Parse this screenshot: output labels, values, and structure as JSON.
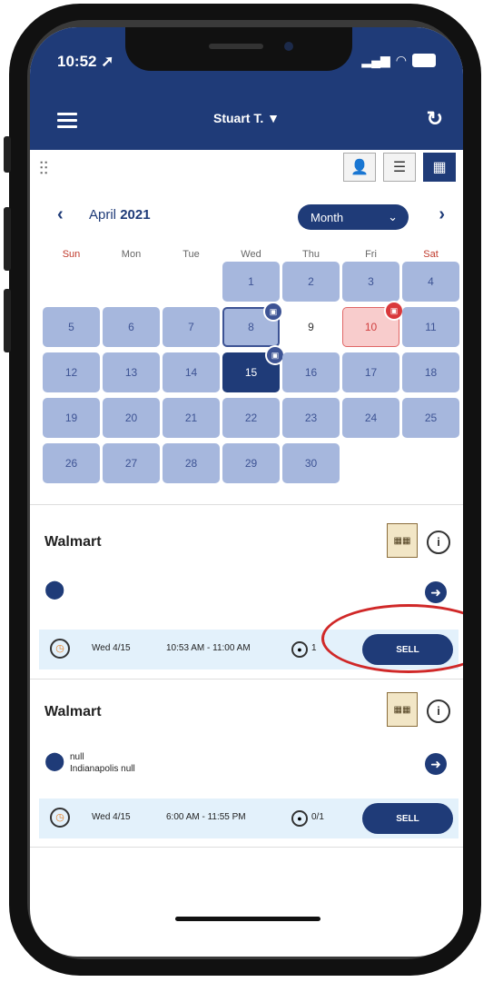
{
  "status": {
    "time": "10:52"
  },
  "header": {
    "user": "Stuart T."
  },
  "calendar": {
    "month": "April",
    "year": "2021",
    "view_mode": "Month",
    "weekdays": [
      "Sun",
      "Mon",
      "Tue",
      "Wed",
      "Thu",
      "Fri",
      "Sat"
    ],
    "days": [
      {
        "d": "",
        "t": "blank"
      },
      {
        "d": "",
        "t": "blank"
      },
      {
        "d": "",
        "t": "blank"
      },
      {
        "d": "1",
        "t": "normal"
      },
      {
        "d": "2",
        "t": "normal"
      },
      {
        "d": "3",
        "t": "normal"
      },
      {
        "d": "4",
        "t": "normal"
      },
      {
        "d": "5",
        "t": "normal"
      },
      {
        "d": "6",
        "t": "normal"
      },
      {
        "d": "7",
        "t": "normal"
      },
      {
        "d": "8",
        "t": "outlined",
        "badge": "blue"
      },
      {
        "d": "9",
        "t": "plain"
      },
      {
        "d": "10",
        "t": "red",
        "badge": "red"
      },
      {
        "d": "11",
        "t": "normal"
      },
      {
        "d": "12",
        "t": "normal"
      },
      {
        "d": "13",
        "t": "normal"
      },
      {
        "d": "14",
        "t": "normal"
      },
      {
        "d": "15",
        "t": "selected",
        "badge": "blue"
      },
      {
        "d": "16",
        "t": "normal"
      },
      {
        "d": "17",
        "t": "normal"
      },
      {
        "d": "18",
        "t": "normal"
      },
      {
        "d": "19",
        "t": "normal"
      },
      {
        "d": "20",
        "t": "normal"
      },
      {
        "d": "21",
        "t": "normal"
      },
      {
        "d": "22",
        "t": "normal"
      },
      {
        "d": "23",
        "t": "normal"
      },
      {
        "d": "24",
        "t": "normal"
      },
      {
        "d": "25",
        "t": "normal"
      },
      {
        "d": "26",
        "t": "normal"
      },
      {
        "d": "27",
        "t": "normal"
      },
      {
        "d": "28",
        "t": "normal"
      },
      {
        "d": "29",
        "t": "normal"
      },
      {
        "d": "30",
        "t": "normal"
      }
    ]
  },
  "events": [
    {
      "store": "Walmart",
      "address_line1": "",
      "address_line2": "",
      "date": "Wed 4/15",
      "time": "10:53 AM - 11:00 AM",
      "count": "1",
      "sell_label": "SELL"
    },
    {
      "store": "Walmart",
      "address_line1": "null",
      "address_line2": "Indianapolis null",
      "date": "Wed 4/15",
      "time": "6:00 AM - 11:55 PM",
      "count": "0/1",
      "sell_label": "SELL"
    }
  ],
  "colors": {
    "primary": "#1f3b78",
    "day": "#a6b7dd",
    "alert": "#d9383b",
    "highlight_oval": "#d02828",
    "shift_bg": "#e3f1fb"
  }
}
